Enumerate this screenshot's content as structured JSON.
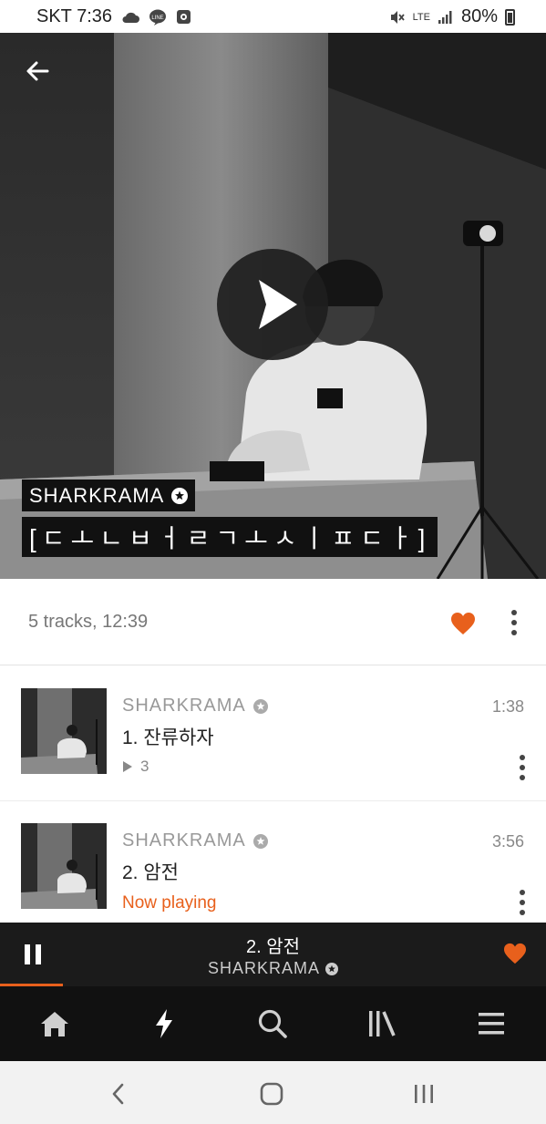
{
  "status_bar": {
    "carrier_time": "SKT 7:36",
    "network": "LTE",
    "battery": "80%"
  },
  "hero": {
    "artist": "SHARKRAMA",
    "title": "[ㄷㅗㄴㅂㅓㄹㄱㅗㅅㅣㅍㄷㅏ]"
  },
  "playlist_info": {
    "summary": "5 tracks, 12:39"
  },
  "tracks": [
    {
      "artist": "SHARKRAMA",
      "title": "1. 잔류하자",
      "duration": "1:38",
      "plays": "3"
    },
    {
      "artist": "SHARKRAMA",
      "title": "2. 암전",
      "duration": "3:56",
      "status": "Now playing"
    }
  ],
  "mini_player": {
    "title": "2. 암전",
    "artist": "SHARKRAMA",
    "progress": 0.115
  },
  "colors": {
    "accent": "#e8601c",
    "dark_bar": "#1b1b1b",
    "nav_bar": "#111111"
  },
  "icons": {
    "back": "arrow-left-icon",
    "play": "play-icon",
    "heart": "heart-icon",
    "more": "more-vertical-icon",
    "pause": "pause-icon",
    "home": "home-icon",
    "stream": "lightning-icon",
    "search": "search-icon",
    "library": "library-icon",
    "menu": "menu-icon"
  }
}
